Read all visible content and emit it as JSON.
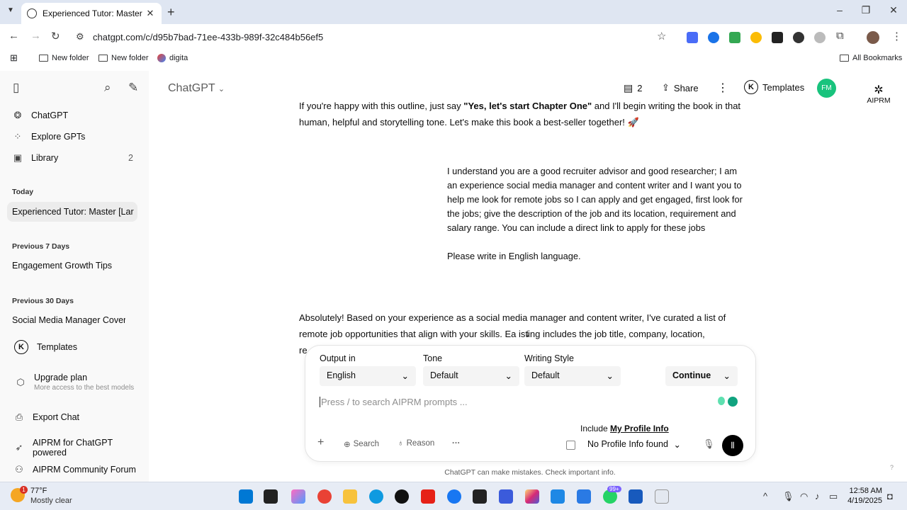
{
  "browser": {
    "tab_title": "Experienced Tutor: Master [Lan",
    "tab_close": "✕",
    "new_tab": "+",
    "url": "chatgpt.com/c/d95b7bad-71ee-433b-989f-32c484b56ef5",
    "bookmarks": [
      "New folder",
      "New folder",
      "digita"
    ],
    "all_bookmarks": "All Bookmarks"
  },
  "sidebar": {
    "nav": [
      {
        "label": "ChatGPT",
        "icon": "openai-icon"
      },
      {
        "label": "Explore GPTs",
        "icon": "grid-icon"
      },
      {
        "label": "Library",
        "icon": "library-icon",
        "count": "2"
      }
    ],
    "today_header": "Today",
    "today_items": [
      "Experienced Tutor: Master [Lar"
    ],
    "prev7_header": "Previous 7 Days",
    "prev7_items": [
      "Engagement Growth Tips"
    ],
    "prev30_header": "Previous 30 Days",
    "prev30_items": [
      "Social Media Manager Cover L"
    ],
    "templates": "Templates",
    "upgrade_title": "Upgrade plan",
    "upgrade_sub": "More access to the best models",
    "export_chat": "Export Chat",
    "aiprm_powered": "AIPRM for ChatGPT powered",
    "aiprm_forum": "AIPRM Community Forum"
  },
  "header": {
    "model": "ChatGPT",
    "doc_count": "2",
    "share": "Share",
    "templates": "Templates",
    "avatar": "FM",
    "aiprm": "AIPRM"
  },
  "chat": {
    "assistant_1_line1_pre": "If you're happy with this outline, just say ",
    "assistant_1_line1_bold": "\"Yes, let's start Chapter One\"",
    "assistant_1_line1_post": " and I'll begin writing the book in that",
    "assistant_1_line2": "human, helpful and storytelling tone. Let's make this book a best-seller together! 🚀",
    "user_msg": "I understand you are a good recruiter advisor and good researcher; I am an experience social media manager and content writer and I want you to help me look for remote jobs so I can apply and get engaged, first look for the jobs; give the description of the job and its location, requirement and salary range. You can include a direct link to apply for these jobs",
    "user_msg_2": "Please write in English language.",
    "assistant_2_line1": "Absolutely! Based on your experience as a social media manager and content writer, I've curated a list of",
    "assistant_2_line2": "remote job opportunities that align with your skills. Ea   isting includes the job title, company, location,",
    "assistant_2_line3": "re"
  },
  "composer": {
    "output_label": "Output in",
    "output_value": "English",
    "tone_label": "Tone",
    "tone_value": "Default",
    "style_label": "Writing Style",
    "style_value": "Default",
    "continue": "Continue",
    "placeholder": "Press / to search AIPRM prompts ...",
    "include": "Include",
    "profile_link": "My Profile Info",
    "profile_select": "No Profile Info found",
    "search": "Search",
    "reason": "Reason",
    "more": "···"
  },
  "footer_note": "ChatGPT can make mistakes. Check important info.",
  "taskbar": {
    "weather_temp": "77°F",
    "weather_desc": "Mostly clear",
    "time": "12:58 AM",
    "date": "4/19/2025",
    "badge": "99+"
  }
}
